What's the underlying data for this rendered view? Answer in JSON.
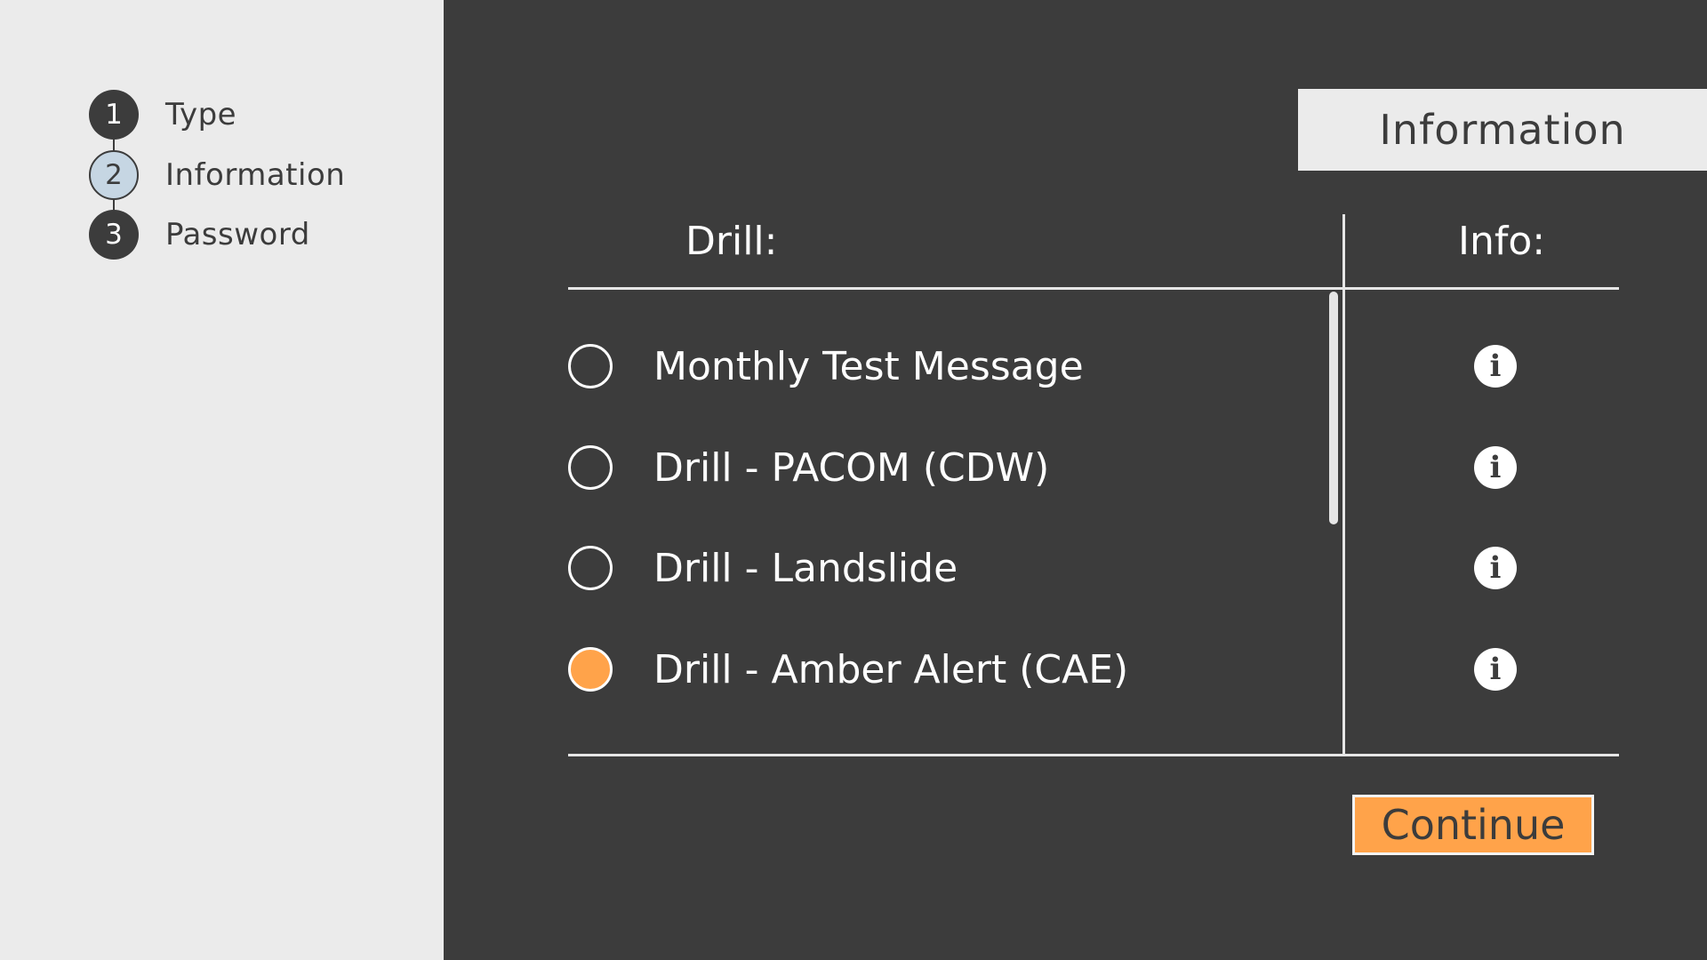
{
  "steps": [
    {
      "number": "1",
      "label": "Type"
    },
    {
      "number": "2",
      "label": "Information"
    },
    {
      "number": "3",
      "label": "Password"
    }
  ],
  "active_step": 2,
  "header": {
    "title": "Information"
  },
  "table": {
    "drill_header": "Drill:",
    "info_header": "Info:"
  },
  "options": [
    {
      "label": "Monthly Test Message",
      "selected": false
    },
    {
      "label": "Drill - PACOM (CDW)",
      "selected": false
    },
    {
      "label": "Drill - Landslide",
      "selected": false
    },
    {
      "label": "Drill - Amber Alert (CAE)",
      "selected": true
    }
  ],
  "info_icon_glyph": "i",
  "continue_label": "Continue",
  "colors": {
    "accent": "#ffa34a",
    "background_dark": "#3c3c3c",
    "sidebar": "#ebebeb",
    "active_step": "#c6d6e3"
  }
}
